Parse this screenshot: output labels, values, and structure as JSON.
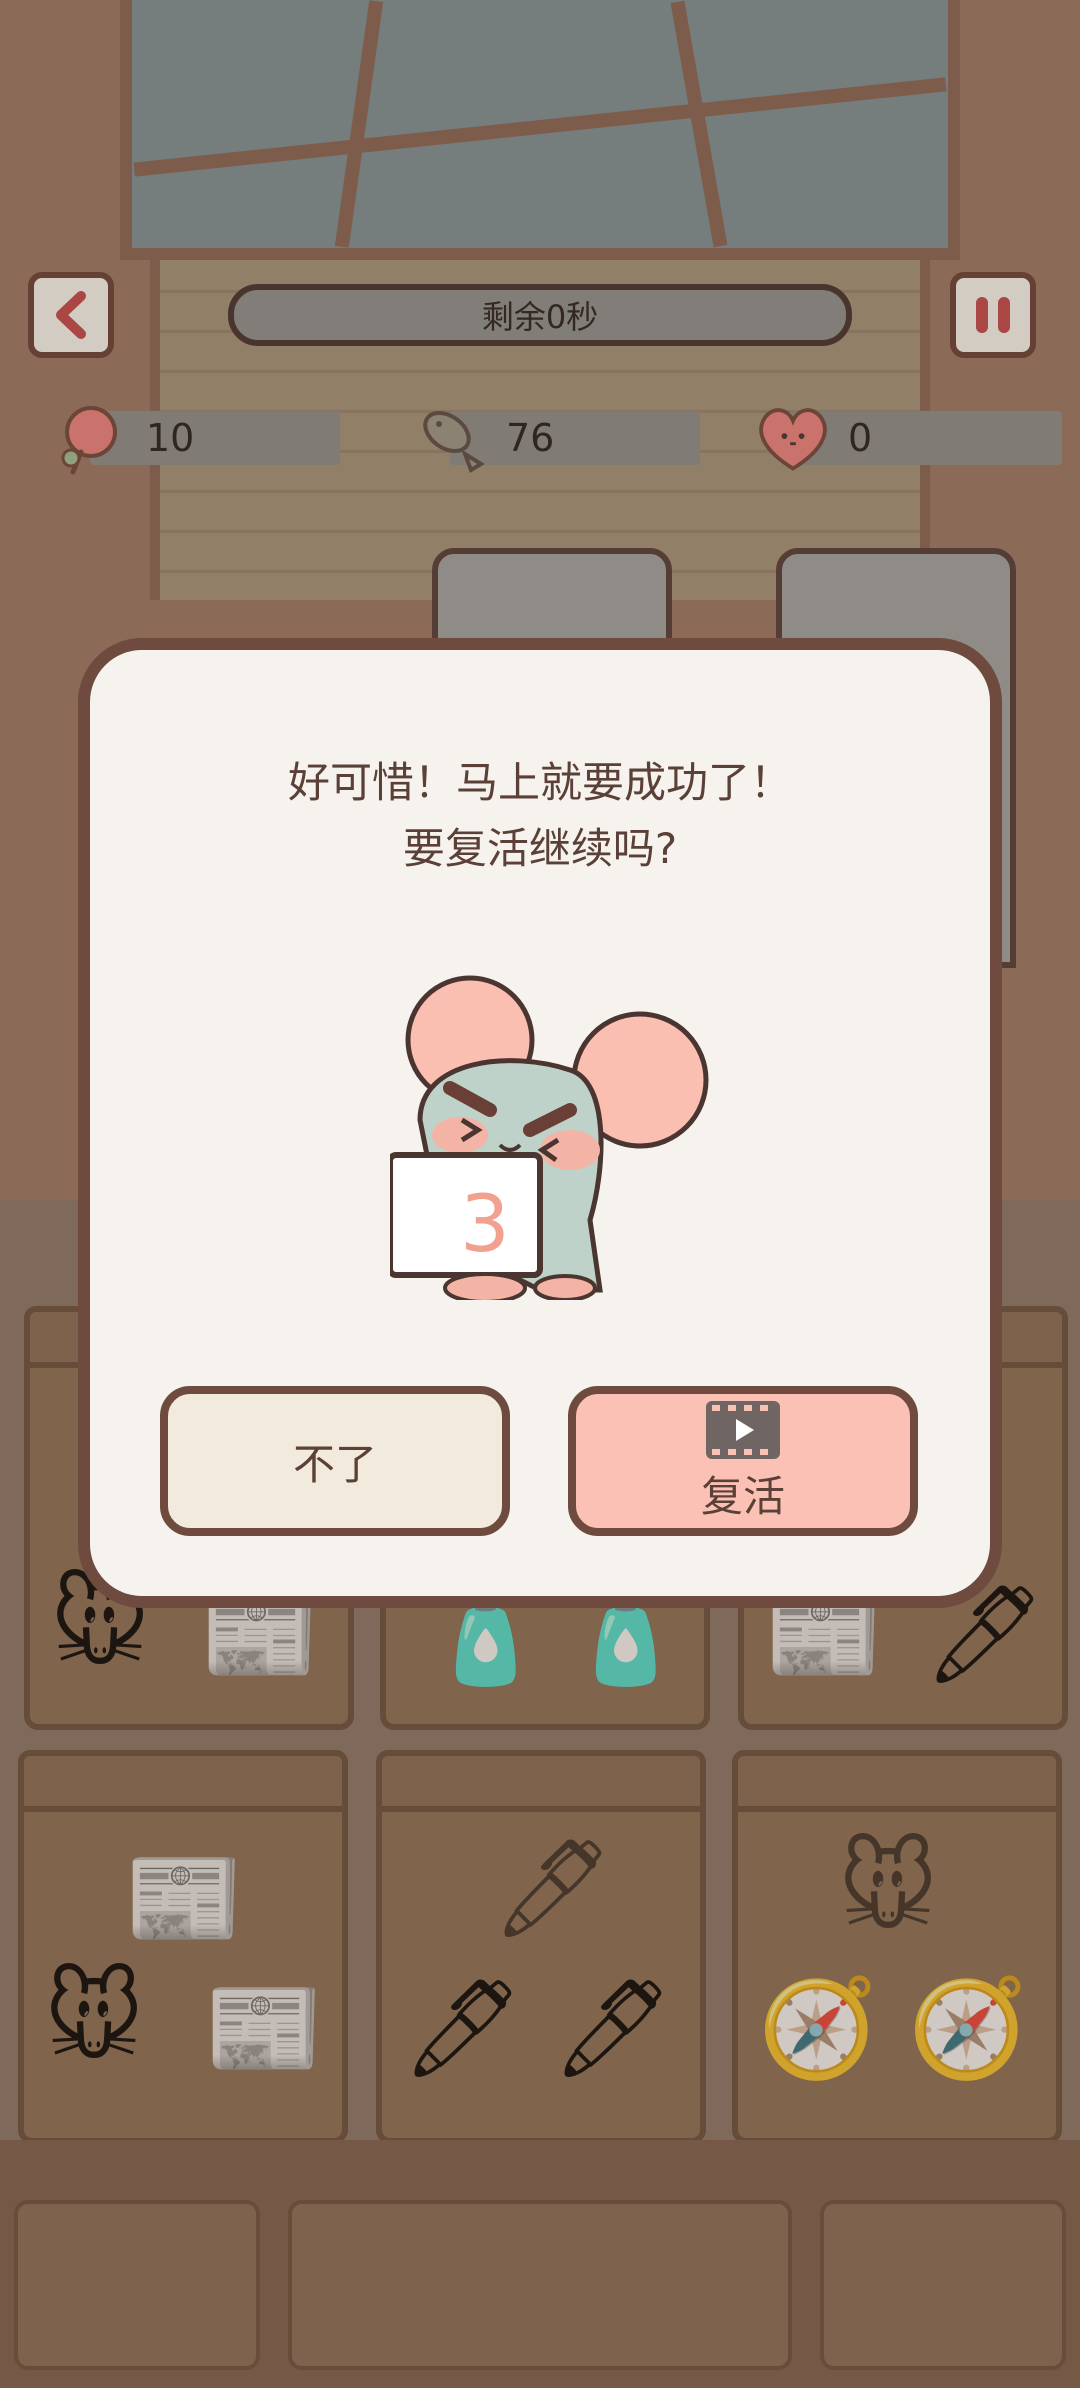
{
  "hud": {
    "timer_text": "剩余0秒",
    "stats": [
      {
        "icon": "flower-icon",
        "value": "10"
      },
      {
        "icon": "fish-icon",
        "value": "76"
      },
      {
        "icon": "heart-face-icon",
        "value": "0"
      }
    ]
  },
  "dialog": {
    "message_line1": "好可惜！马上就要成功了！",
    "message_line2": "要复活继续吗?",
    "countdown": "3",
    "no_label": "不了",
    "revive_label": "复活"
  },
  "colors": {
    "dialog_bg": "#f6f3ee",
    "dialog_border": "#6e4a3f",
    "revive_button": "#fcc1b5",
    "no_button": "#f2ebdd",
    "countdown_text": "#f2a08f"
  }
}
